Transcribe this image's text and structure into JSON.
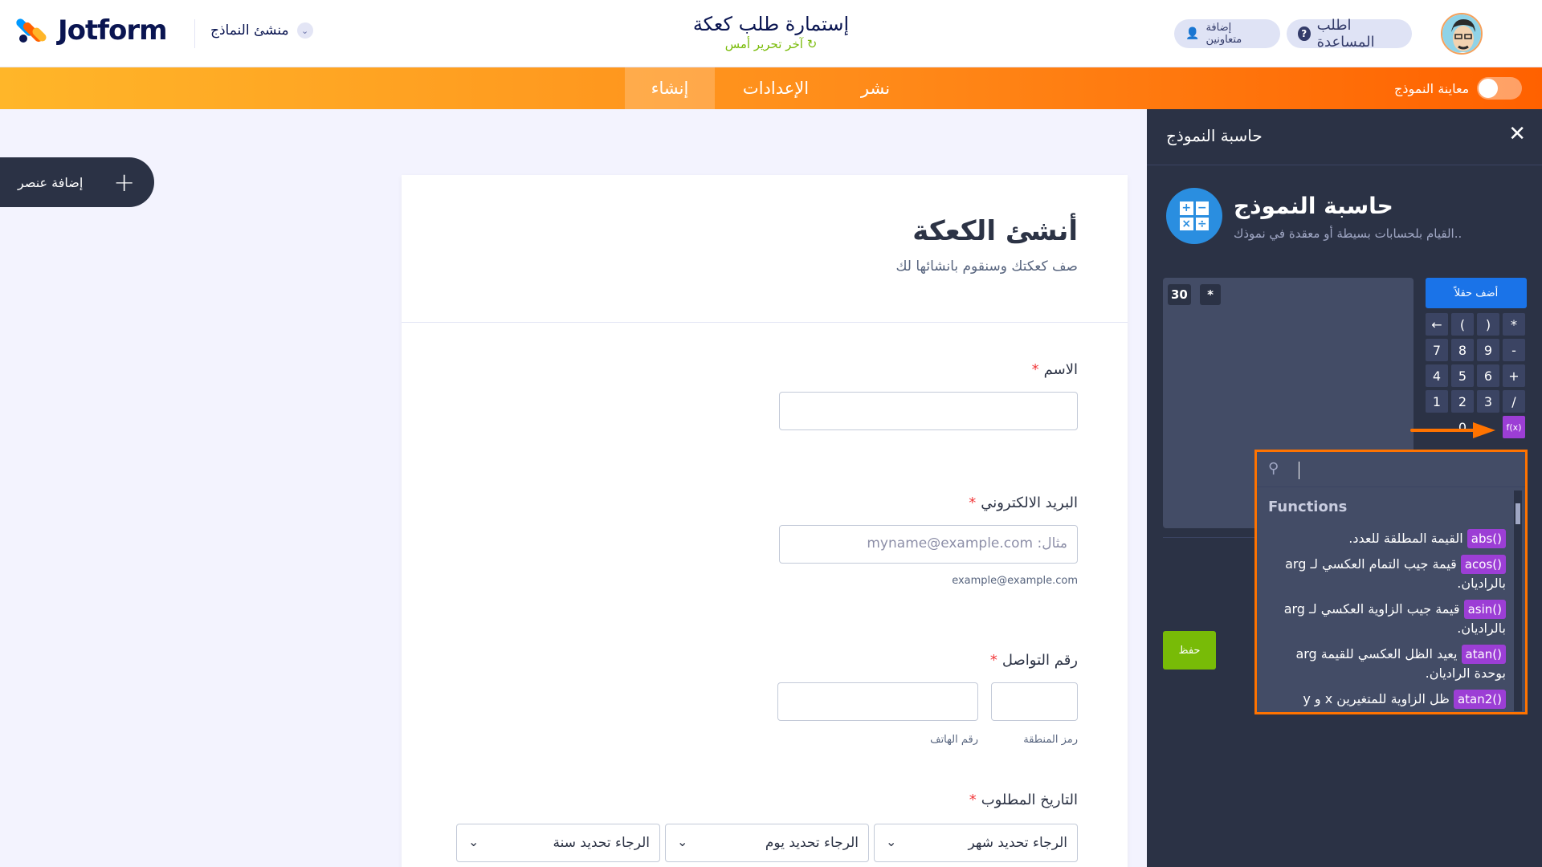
{
  "header": {
    "logo_text": "Jotform",
    "builder_label": "منشئ النماذج",
    "form_title": "إستمارة طلب كعكة",
    "last_edit": "آخر تحرير أمس",
    "help_label": "اطلب المساعدة",
    "invite_label": "إضافة متعاونين"
  },
  "nav": {
    "build": "إنشاء",
    "settings": "الإعدادات",
    "publish": "نشر",
    "preview": "معاينة النموذج"
  },
  "add_element": {
    "label": "إضافة عنصر"
  },
  "form": {
    "heading": "أنشئ الكعكة",
    "description": "صف كعكتك وسنقوم بانشائها لك",
    "required_mark": "*",
    "name_label": "الاسم",
    "email_label": "البريد الالكتروني",
    "email_placeholder": "مثال: myname@example.com",
    "email_sublabel": "example@example.com",
    "phone_label": "رقم التواصل",
    "area_code_sublabel": "رمز المنطقة",
    "phone_sublabel": "رقم الهاتف",
    "date_label": "التاريخ المطلوب",
    "month_select": "الرجاء تحديد شهر",
    "day_select": "الرجاء تحديد يوم",
    "year_select": "الرجاء تحديد سنة"
  },
  "panel": {
    "title": "حاسبة النموذج",
    "heading": "حاسبة النموذج",
    "subtitle": "القيام بلحسابات بسيطة أو معقدة في نموذك..",
    "add_field": "أضف حقلاً",
    "save": "حفظ",
    "formula_tokens": [
      "30",
      "*"
    ],
    "keypad": [
      "←",
      "(",
      ")",
      "*",
      "7",
      "8",
      "9",
      "-",
      "4",
      "5",
      "6",
      "+",
      "1",
      "2",
      "3",
      "/",
      "",
      "0",
      "",
      "f(x)"
    ]
  },
  "functions": {
    "title": "Functions",
    "items": [
      {
        "tag": "abs()",
        "desc": "القيمة المطلقة للعدد."
      },
      {
        "tag": "acos()",
        "desc": "قيمة جيب التمام العكسي لـ arg بالراديان."
      },
      {
        "tag": "asin()",
        "desc": "قيمة جيب الزاوية العكسي لـ arg بالراديان."
      },
      {
        "tag": "atan()",
        "desc": "يعيد الظل العكسي للقيمة arg بوحدة الراديان."
      },
      {
        "tag": "atan2()",
        "desc": "ظل الزاوية للمتغيرين x و y"
      }
    ]
  },
  "colors": {
    "accent_orange": "#ff7300",
    "panel_bg": "#2b3245",
    "fx_purple": "#9c3ed5",
    "save_green": "#78bb07",
    "primary_blue": "#1a73e8"
  }
}
